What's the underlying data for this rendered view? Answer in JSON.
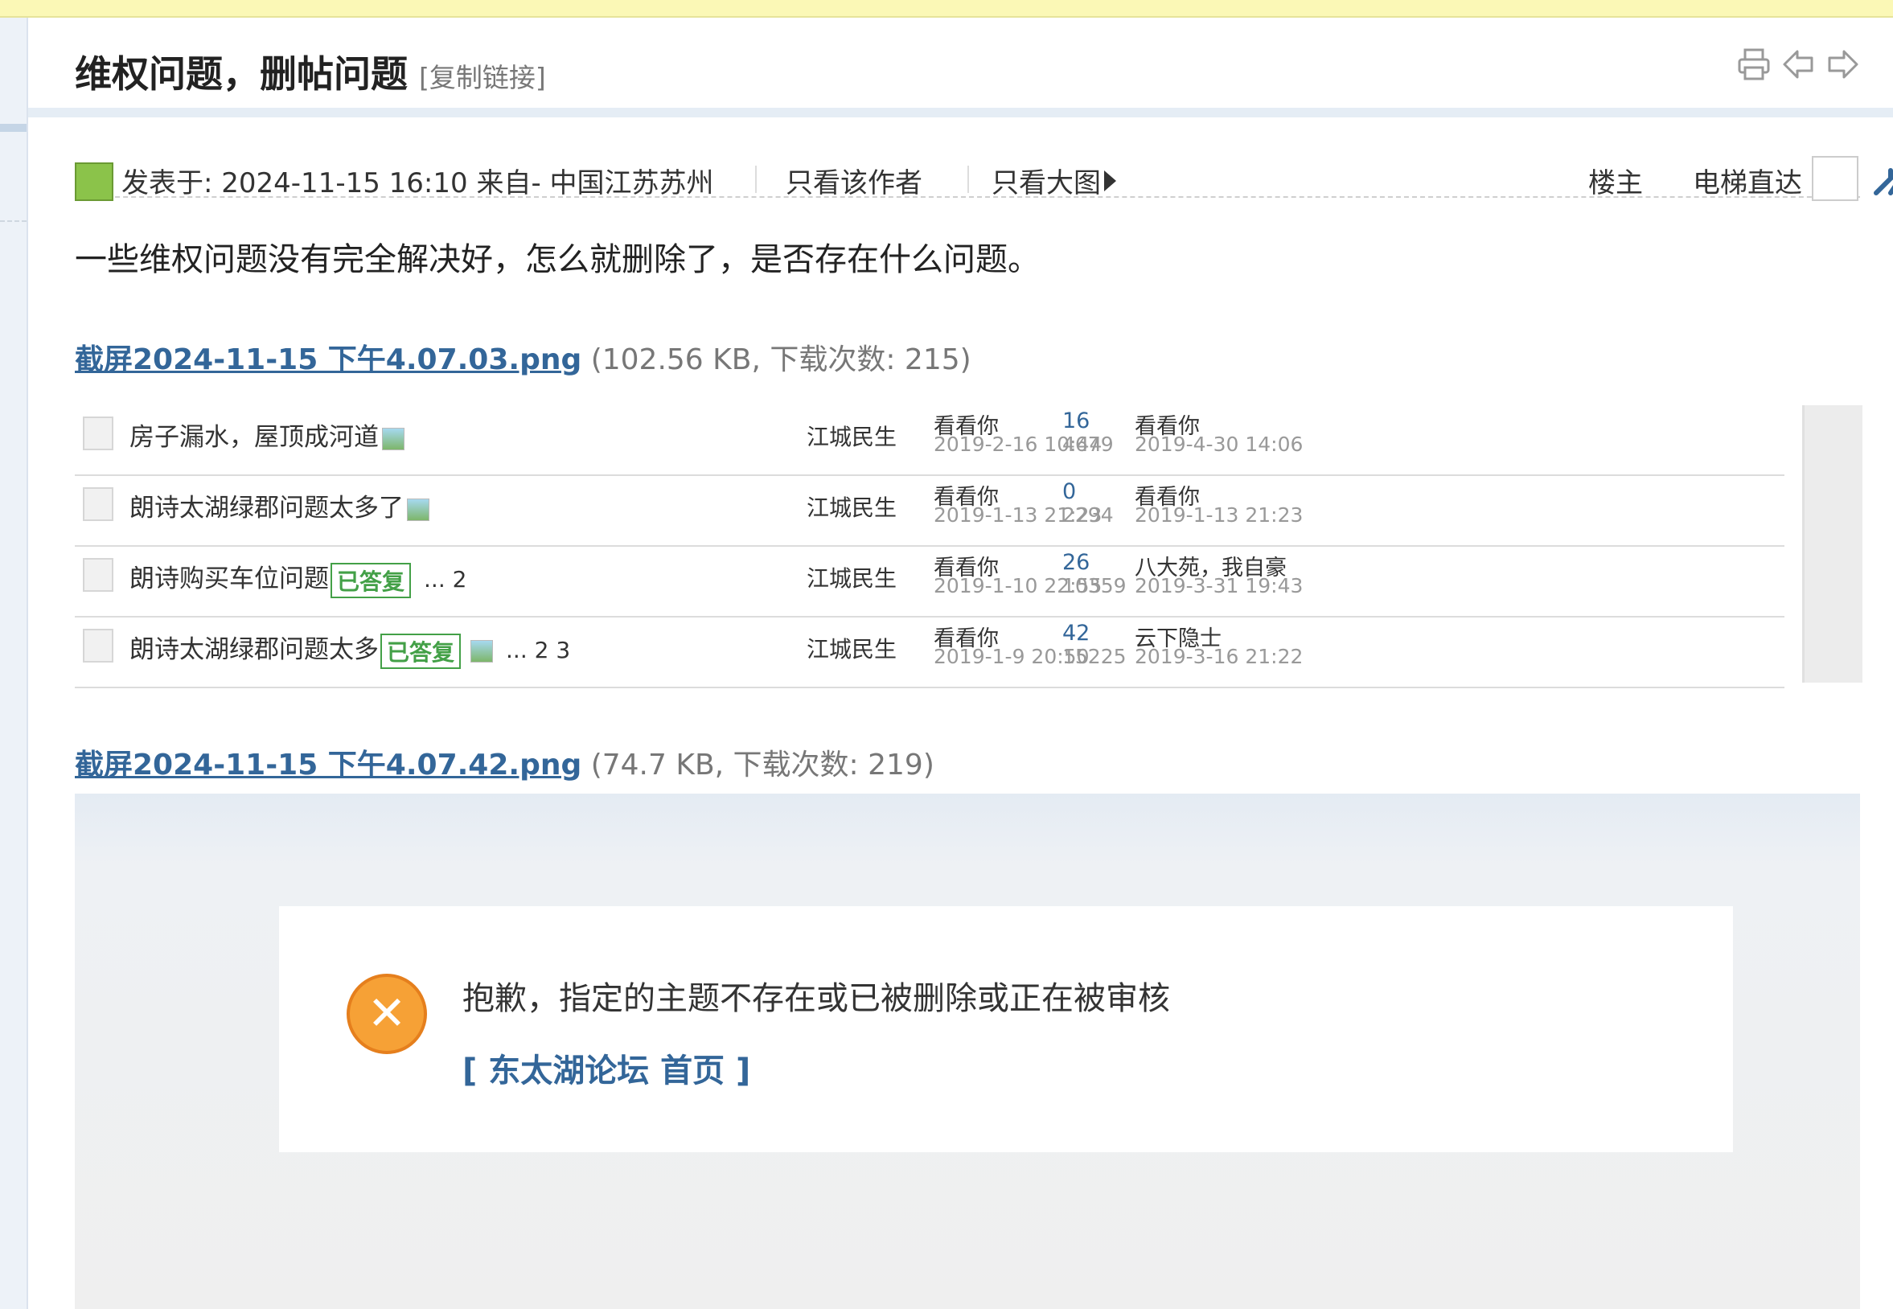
{
  "post": {
    "title": "维权问题，删帖问题",
    "copy_link": "[复制链接]",
    "meta": {
      "posted_at": "发表于: 2024-11-15 16:10 来自- 中国江苏苏州",
      "only_author": "只看该作者",
      "only_large_images": "只看大图",
      "floor_owner": "楼主",
      "elevator": "电梯直达"
    },
    "body": "一些维权问题没有完全解决好，怎么就删除了，是否存在什么问题。"
  },
  "toolbar": {
    "icons": [
      "print-icon",
      "prev-thread-icon",
      "next-thread-icon"
    ]
  },
  "attachments": [
    {
      "name": "截屏2024-11-15 下午4.07.03.png",
      "info": "(102.56 KB, 下载次数: 215)"
    },
    {
      "name": "截屏2024-11-15 下午4.07.42.png",
      "info": "(74.7 KB, 下载次数: 219)"
    }
  ],
  "thread_list": {
    "rows": [
      {
        "title": "房子漏水，屋顶成河道",
        "has_image": true,
        "answered": "",
        "pages": "",
        "author": "江城民生",
        "poster": "看看你",
        "post_date": "2019-2-16 10:44",
        "replies": "16",
        "views": "4679",
        "last_user": "看看你",
        "last_date": "2019-4-30 14:06"
      },
      {
        "title": "朗诗太湖绿郡问题太多了",
        "has_image": true,
        "answered": "",
        "pages": "",
        "author": "江城民生",
        "poster": "看看你",
        "post_date": "2019-1-13 21:23",
        "replies": "0",
        "views": "2294",
        "last_user": "看看你",
        "last_date": "2019-1-13 21:23"
      },
      {
        "title": "朗诗购买车位问题",
        "has_image": false,
        "answered": "已答复",
        "pages": "... 2",
        "author": "江城民生",
        "poster": "看看你",
        "post_date": "2019-1-10 22:55",
        "replies": "26",
        "views": "10359",
        "last_user": "八大苑，我自豪",
        "last_date": "2019-3-31 19:43"
      },
      {
        "title": "朗诗太湖绿郡问题太多",
        "has_image": true,
        "answered": "已答复",
        "pages": "... 2  3",
        "author": "江城民生",
        "poster": "看看你",
        "post_date": "2019-1-9 20:50",
        "replies": "42",
        "views": "15225",
        "last_user": "云下隐士",
        "last_date": "2019-3-16 21:22"
      }
    ]
  },
  "notice": {
    "icon": "error-x-icon",
    "message": "抱歉，指定的主题不存在或已被删除或正在被审核",
    "home_link": "[ 东太湖论坛 首页 ]"
  },
  "colors": {
    "link": "#336699",
    "answered_badge": "#43a047",
    "error_icon": "#f6a136",
    "top_banner": "#fbf8b6"
  }
}
